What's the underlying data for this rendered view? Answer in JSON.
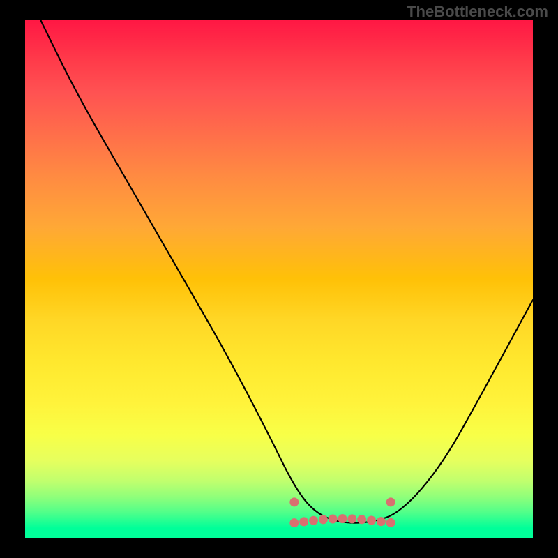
{
  "watermark": "TheBottleneck.com",
  "chart_data": {
    "type": "line",
    "title": "",
    "xlabel": "",
    "ylabel": "",
    "xlim": [
      0,
      100
    ],
    "ylim": [
      0,
      100
    ],
    "series": [
      {
        "name": "bottleneck-curve",
        "x": [
          3,
          10,
          20,
          30,
          40,
          48,
          53,
          57,
          62,
          68,
          74,
          82,
          90,
          100
        ],
        "y": [
          100,
          86,
          69,
          52,
          35,
          20,
          10,
          5,
          3,
          3,
          5,
          14,
          28,
          46
        ]
      }
    ],
    "annotations": [
      {
        "name": "dotted-segment",
        "x_range": [
          53,
          72
        ],
        "y": 3,
        "color": "#d97070"
      }
    ],
    "background_gradient": {
      "stops": [
        {
          "pos": 0,
          "color": "#ff1744"
        },
        {
          "pos": 50,
          "color": "#ffc107"
        },
        {
          "pos": 85,
          "color": "#e6ff5e"
        },
        {
          "pos": 100,
          "color": "#00ff99"
        }
      ]
    }
  }
}
